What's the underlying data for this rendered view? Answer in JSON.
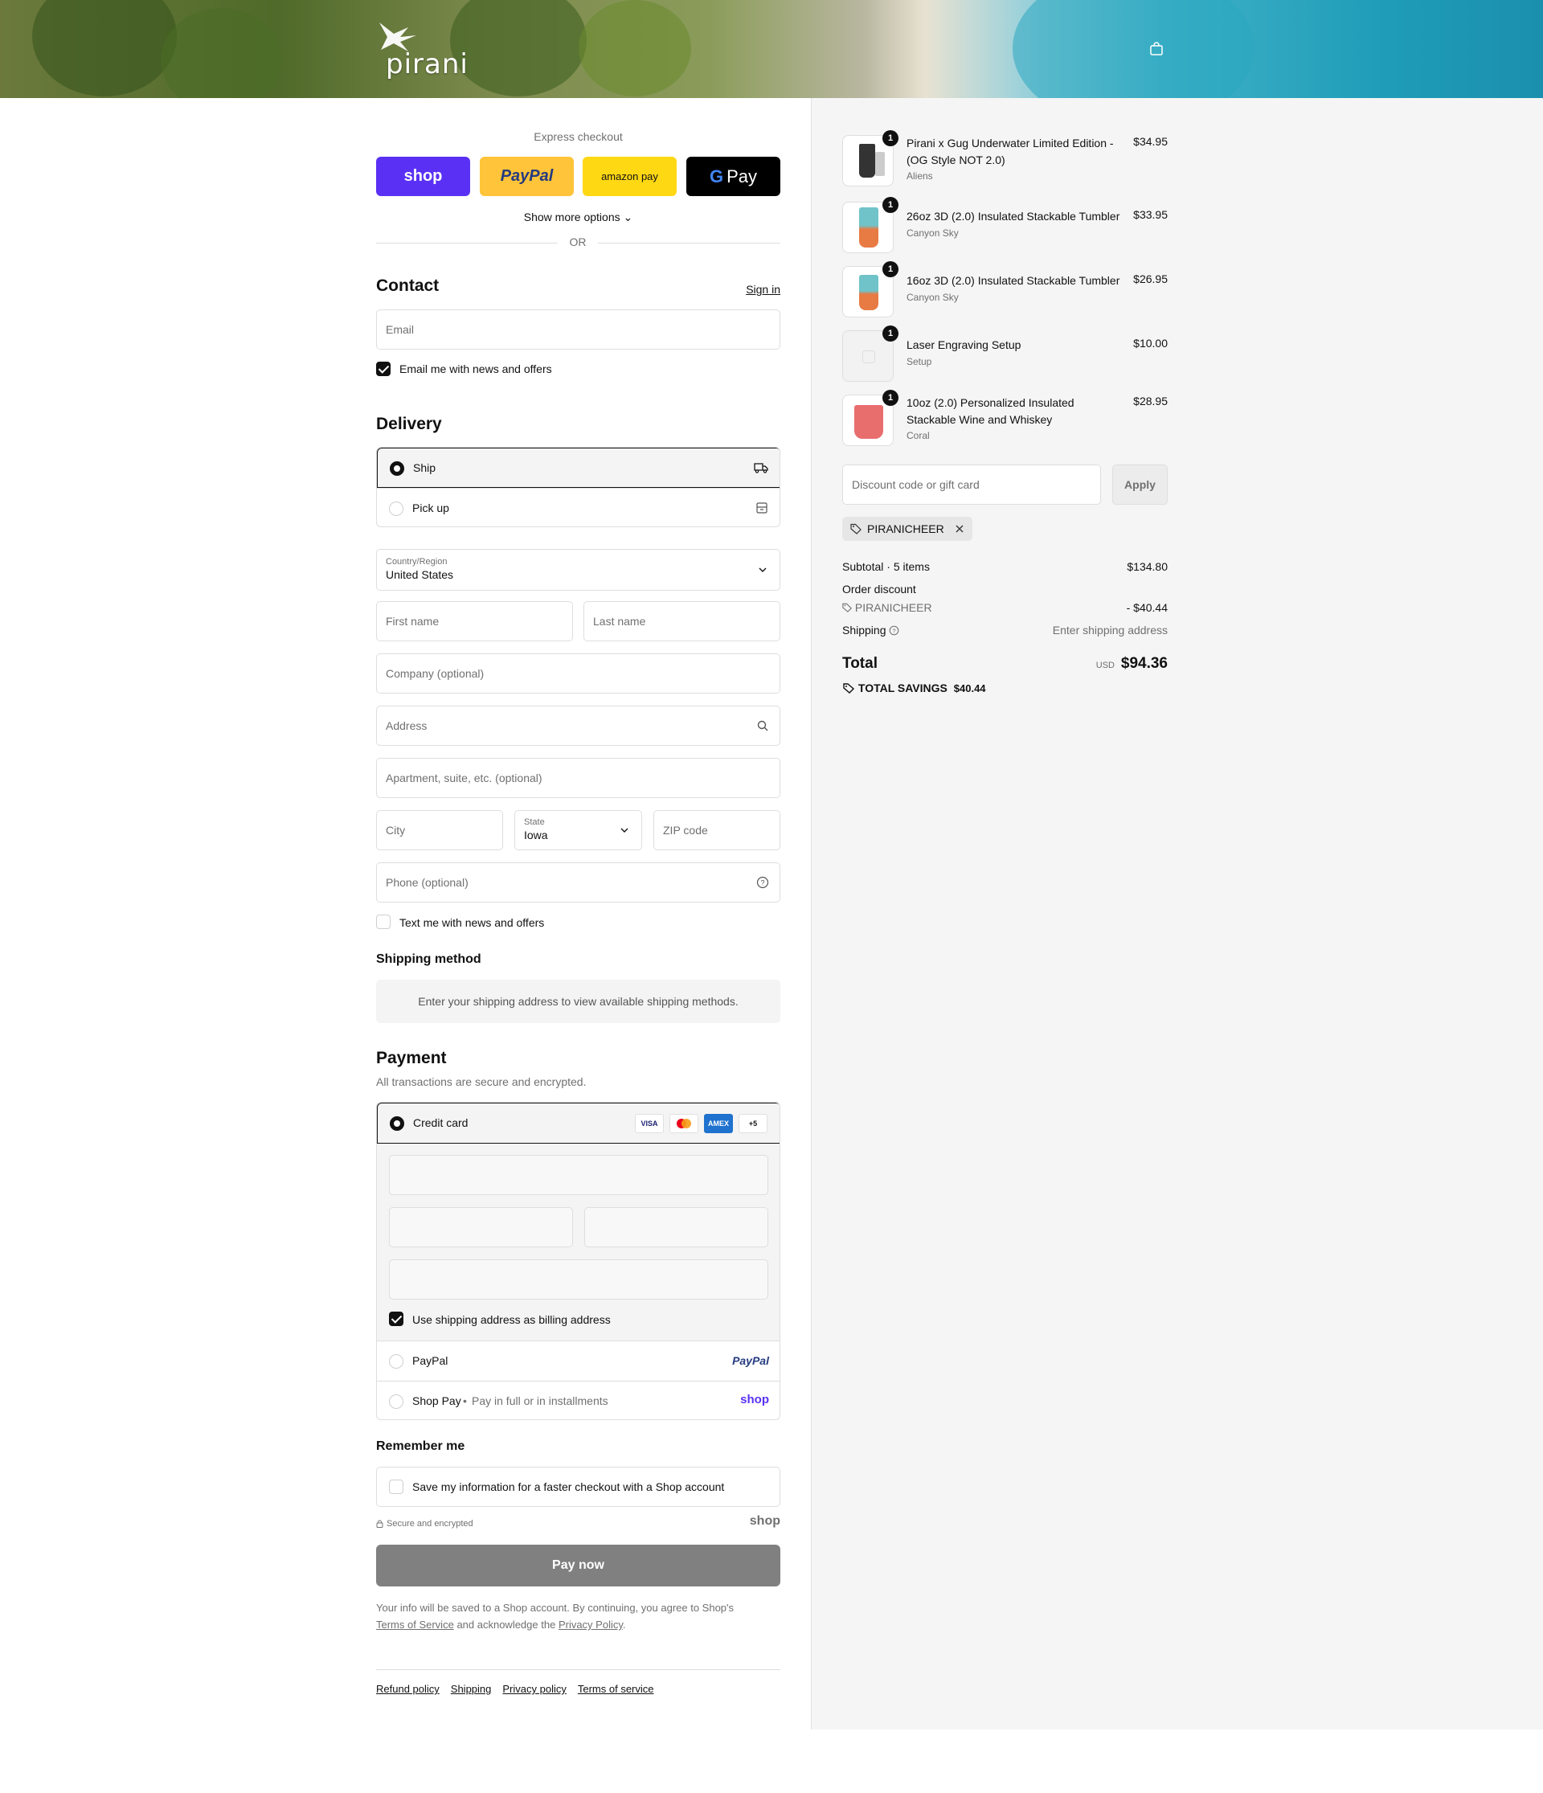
{
  "header": {
    "logo_text": "pirani",
    "cart_icon": "bag-icon"
  },
  "express": {
    "title": "Express checkout",
    "shop_label": "shop",
    "paypal_label": "PayPal",
    "amazon_label": "amazon pay",
    "gpay_label": "Pay",
    "more_label": "Show more options",
    "or_label": "OR",
    "colors": {
      "shop": "#5a31f4",
      "paypal": "#ffc439",
      "amazon": "#ffd814",
      "gpay": "#000000"
    }
  },
  "contact": {
    "title": "Contact",
    "signin_label": "Sign in",
    "email_placeholder": "Email",
    "news_label": "Email me with news and offers",
    "news_checked": true
  },
  "delivery": {
    "title": "Delivery",
    "ship_label": "Ship",
    "pickup_label": "Pick up",
    "country_label": "Country/Region",
    "country_value": "United States",
    "first_name_placeholder": "First name",
    "last_name_placeholder": "Last name",
    "company_placeholder": "Company (optional)",
    "address_placeholder": "Address",
    "apartment_placeholder": "Apartment, suite, etc. (optional)",
    "city_placeholder": "City",
    "state_label": "State",
    "state_value": "Iowa",
    "zip_placeholder": "ZIP code",
    "phone_placeholder": "Phone (optional)",
    "text_label": "Text me with news and offers"
  },
  "shipping_method": {
    "title": "Shipping method",
    "message": "Enter your shipping address to view available shipping methods."
  },
  "payment": {
    "title": "Payment",
    "subtitle": "All transactions are secure and encrypted.",
    "credit_card_label": "Credit card",
    "card_brands": [
      "VISA",
      "MC",
      "AMEX",
      "+5"
    ],
    "billing_label": "Use shipping address as billing address",
    "billing_checked": true,
    "paypal_label": "PayPal",
    "paypal_logo": "PayPal",
    "shoppay_label": "Shop Pay",
    "shoppay_sub": "Pay in full or in installments",
    "shoppay_logo": "shop"
  },
  "remember": {
    "title": "Remember me",
    "save_label": "Save my information for a faster checkout with a Shop account",
    "secure_label": "Secure and encrypted",
    "shop_logo": "shop"
  },
  "pay_now_label": "Pay now",
  "legal": {
    "text_1": "Your info will be saved to a Shop account. By continuing, you agree to Shop's",
    "tos_link": "Terms of Service",
    "text_2": "and acknowledge the",
    "privacy_link": "Privacy Policy",
    "text_3": "."
  },
  "footer_links": [
    "Refund policy",
    "Shipping",
    "Privacy policy",
    "Terms of service"
  ],
  "cart": {
    "items": [
      {
        "name": "Pirani x Gug Underwater Limited Edition - (OG Style NOT 2.0)",
        "variant": "Aliens",
        "price": "$34.95",
        "qty": "1"
      },
      {
        "name": "26oz 3D (2.0) Insulated Stackable Tumbler",
        "variant": "Canyon Sky",
        "price": "$33.95",
        "qty": "1"
      },
      {
        "name": "16oz 3D (2.0) Insulated Stackable Tumbler",
        "variant": "Canyon Sky",
        "price": "$26.95",
        "qty": "1"
      },
      {
        "name": "Laser Engraving Setup",
        "variant": "Setup",
        "price": "$10.00",
        "qty": "1"
      },
      {
        "name": "10oz (2.0) Personalized Insulated Stackable Wine and Whiskey",
        "variant": "Coral",
        "price": "$28.95",
        "qty": "1"
      }
    ],
    "discount_placeholder": "Discount code or gift card",
    "apply_label": "Apply",
    "applied_code": "PIRANICHEER",
    "subtotal_label": "Subtotal · 5 items",
    "subtotal_value": "$134.80",
    "order_discount_label": "Order discount",
    "discount_code": "PIRANICHEER",
    "discount_value": "- $40.44",
    "shipping_label": "Shipping",
    "shipping_value": "Enter shipping address",
    "total_label": "Total",
    "currency": "USD",
    "total_value": "$94.36",
    "savings_label": "TOTAL SAVINGS",
    "savings_value": "$40.44"
  }
}
